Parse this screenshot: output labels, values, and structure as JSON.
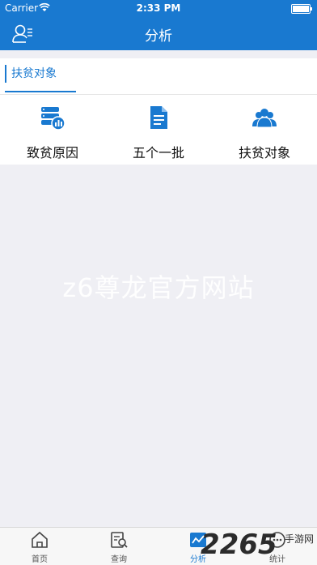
{
  "status_bar": {
    "carrier": "Carrier",
    "time": "2:33 PM"
  },
  "nav": {
    "title": "分析"
  },
  "tabs": [
    {
      "label": "扶贫对象"
    }
  ],
  "grid": [
    {
      "label": "致贫原因",
      "icon": "database-chart-icon"
    },
    {
      "label": "五个一批",
      "icon": "document-icon"
    },
    {
      "label": "扶贫对象",
      "icon": "group-icon"
    }
  ],
  "watermark": "z6尊龙官方网站",
  "tabbar": [
    {
      "label": "首页",
      "icon": "home-icon",
      "active": false
    },
    {
      "label": "查询",
      "icon": "query-icon",
      "active": false
    },
    {
      "label": "分析",
      "icon": "analysis-icon",
      "active": true
    },
    {
      "label": "统计",
      "icon": "statistics-icon",
      "active": false
    }
  ],
  "brand_watermark": {
    "number": "2265",
    "text": "手游网"
  },
  "colors": {
    "primary": "#1979d0",
    "background": "#efeff4"
  }
}
